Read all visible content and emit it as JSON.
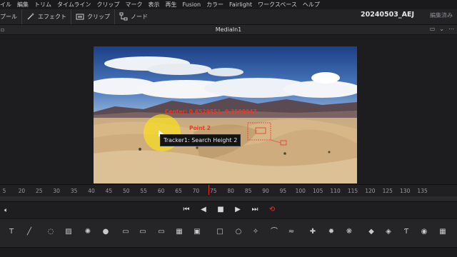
{
  "menu": [
    "イル",
    "編集",
    "トリム",
    "タイムライン",
    "クリップ",
    "マーク",
    "表示",
    "再生",
    "Fusion",
    "カラー",
    "Fairlight",
    "ワークスペース",
    "ヘルプ"
  ],
  "project": {
    "name": "20240503_AEJ",
    "status": "編集済み"
  },
  "toolbar": {
    "pool": "プール",
    "effects": "エフェクト",
    "clips": "クリップ",
    "nodes": "ノード"
  },
  "viewer": {
    "title": "MediaIn1"
  },
  "overlay": {
    "center_text": "Center: 0.6529851, 0.3509947",
    "point_text": "Point 2",
    "tooltip": "Tracker1: Search Height 2"
  },
  "ruler": {
    "ticks": [
      "5",
      "20",
      "25",
      "30",
      "35",
      "40",
      "45",
      "50",
      "55",
      "60",
      "65",
      "70",
      "75",
      "80",
      "85",
      "90",
      "95",
      "100",
      "105",
      "110",
      "115",
      "120",
      "125",
      "130",
      "135"
    ],
    "playhead_frame": 74
  },
  "colors": {
    "accent_red": "#e23b2a",
    "highlight": "#f6de1e",
    "bg": "#1c1c1e"
  },
  "transport": [
    "skip-to-start-icon",
    "play-reverse-icon",
    "stop-icon",
    "play-icon",
    "skip-to-end-icon",
    "loop-icon"
  ],
  "tools": [
    "text-tool-icon",
    "paint-tool-icon",
    "background-tool-icon",
    "gradient-tool-icon",
    "brightness-contrast-icon",
    "blur-icon",
    "merge-icon",
    "transform-icon",
    "crop-icon",
    "resize-icon",
    "channel-boolean-icon",
    "ellipse-mask-icon",
    "rectangle-mask-icon",
    "polygon-mask-icon",
    "bspline-mask-icon",
    "paint-mask-icon",
    "particle-icon",
    "emitter-icon",
    "render-icon",
    "shape3d-icon",
    "merge3d-icon",
    "text3d-icon",
    "camera3d-icon",
    "renderer3d-icon"
  ]
}
